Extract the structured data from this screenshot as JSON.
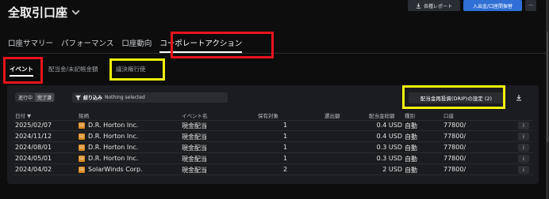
{
  "header": {
    "title": "全取引口座",
    "reports_label": "各種レポート",
    "deposit_label": "入出金/口座間振替",
    "more_label": "···"
  },
  "tabs": [
    {
      "label": "口座サマリー"
    },
    {
      "label": "パフォーマンス"
    },
    {
      "label": "口座動向"
    },
    {
      "label": "コーポレートアクション"
    }
  ],
  "sub_tabs": [
    {
      "label": "イベント"
    },
    {
      "label": "配当金/未記帳金額"
    },
    {
      "label": "議決権行使"
    }
  ],
  "toolbar": {
    "status_on": "進行中",
    "status_done": "完了済",
    "filter_label": "絞り込み",
    "filter_value": "Nothing selected",
    "drip_label": "配当金再投資(DRIP)の設定 (2)"
  },
  "table": {
    "headers": [
      "日付 ▼",
      "銘柄",
      "イベント名",
      "保有対象",
      "選出額",
      "配当金総額",
      "種別",
      "口座"
    ],
    "rows": [
      {
        "date": "2025/02/07",
        "symbol": "D.R. Horton Inc.",
        "event": "現金配当",
        "holding": "1",
        "amount": "0.4 USD",
        "type": "自動",
        "account": "77800/"
      },
      {
        "date": "2024/11/12",
        "symbol": "D.R. Horton Inc.",
        "event": "現金配当",
        "holding": "1",
        "amount": "0.4 USD",
        "type": "自動",
        "account": "77800/"
      },
      {
        "date": "2024/08/01",
        "symbol": "D.R. Horton Inc.",
        "event": "現金配当",
        "holding": "1",
        "amount": "0.3 USD",
        "type": "自動",
        "account": "77800/"
      },
      {
        "date": "2024/05/01",
        "symbol": "D.R. Horton Inc.",
        "event": "現金配当",
        "holding": "1",
        "amount": "0.3 USD",
        "type": "自動",
        "account": "77800/"
      },
      {
        "date": "2024/04/02",
        "symbol": "SolarWinds Corp.",
        "event": "現金配当",
        "holding": "2",
        "amount": "2 USD",
        "type": "自動",
        "account": "77800/"
      }
    ],
    "info_label": "i"
  },
  "colors": {
    "accent_blue": "#2f6fd6",
    "highlight_red": "#e8141b",
    "highlight_yellow": "#f2f20a",
    "badge_orange": "#d98b1f"
  }
}
